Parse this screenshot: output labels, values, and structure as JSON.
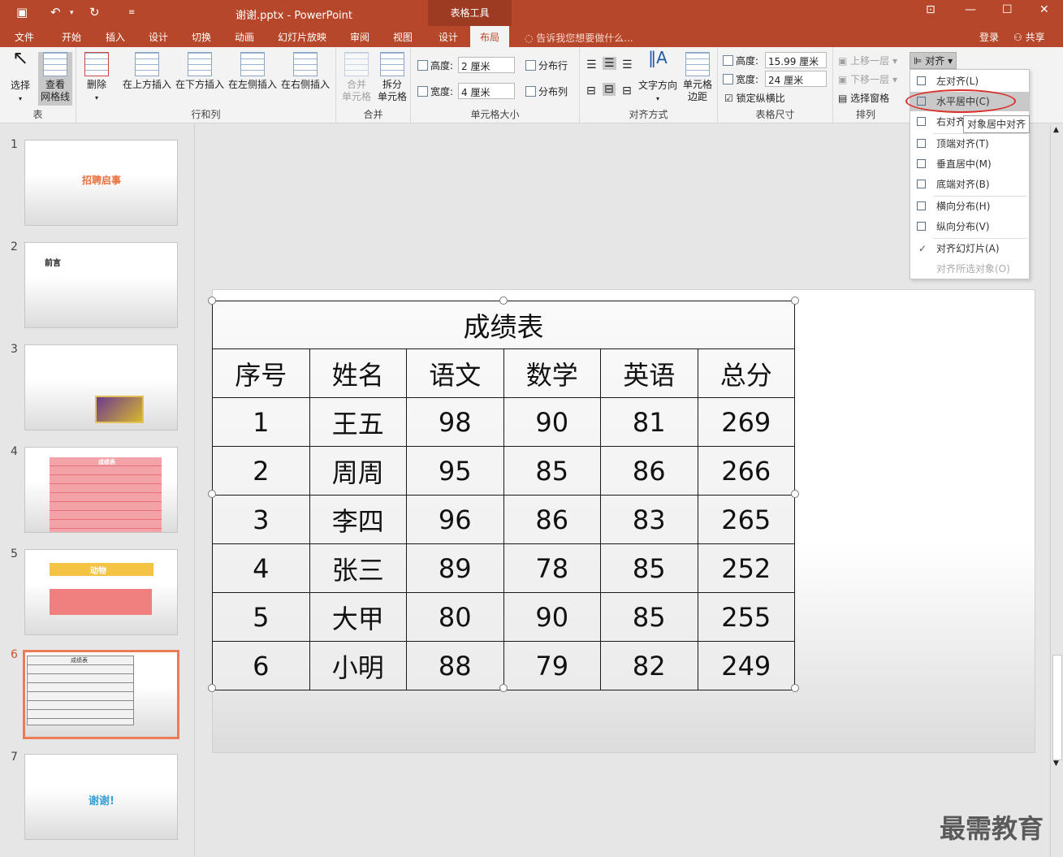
{
  "app": {
    "title": "谢谢.pptx - PowerPoint",
    "context_tab_group": "表格工具"
  },
  "tabs": [
    "文件",
    "开始",
    "插入",
    "设计",
    "切换",
    "动画",
    "幻灯片放映",
    "审阅",
    "视图",
    "设计",
    "布局"
  ],
  "active_tab": "布局",
  "tell_me": "告诉我您想要做什么...",
  "account": {
    "login": "登录",
    "share": "共享"
  },
  "ribbon": {
    "table": {
      "label": "表",
      "select": "选择",
      "view_gridlines": "查看\n网格线"
    },
    "rows_cols": {
      "label": "行和列",
      "delete": "删除",
      "insert_above": "在上方插入",
      "insert_below": "在下方插入",
      "insert_left": "在左侧插入",
      "insert_right": "在右侧插入"
    },
    "merge": {
      "label": "合并",
      "merge_cells": "合并\n单元格",
      "split_cells": "拆分\n单元格"
    },
    "cell_size": {
      "label": "单元格大小",
      "height_label": "高度:",
      "height_value": "2 厘米",
      "width_label": "宽度:",
      "width_value": "4 厘米",
      "distribute_rows": "分布行",
      "distribute_cols": "分布列"
    },
    "alignment": {
      "label": "对齐方式",
      "text_direction": "文字方向",
      "cell_margins": "单元格\n边距"
    },
    "table_size": {
      "label": "表格尺寸",
      "height_label": "高度:",
      "height_value": "15.99 厘米",
      "width_label": "宽度:",
      "width_value": "24 厘米",
      "lock_ratio": "锁定纵横比"
    },
    "arrange": {
      "label": "排列",
      "bring_forward": "上移一层",
      "send_backward": "下移一层",
      "selection_pane": "选择窗格",
      "align": "对齐"
    }
  },
  "align_menu": {
    "items": [
      {
        "label": "左对齐(L)",
        "state": "normal"
      },
      {
        "label": "水平居中(C)",
        "state": "highlighted"
      },
      {
        "label": "右对齐",
        "state": "normal"
      },
      {
        "label": "顶端对齐(T)",
        "state": "normal"
      },
      {
        "label": "垂直居中(M)",
        "state": "normal"
      },
      {
        "label": "底端对齐(B)",
        "state": "normal"
      },
      {
        "label": "横向分布(H)",
        "state": "normal"
      },
      {
        "label": "纵向分布(V)",
        "state": "normal"
      },
      {
        "label": "对齐幻灯片(A)",
        "state": "checked"
      },
      {
        "label": "对齐所选对象(O)",
        "state": "disabled"
      }
    ],
    "tooltip": "对象居中对齐"
  },
  "slides": [
    {
      "num": "1",
      "title": "招聘启事"
    },
    {
      "num": "2",
      "title": "前言"
    },
    {
      "num": "3",
      "title": ""
    },
    {
      "num": "4",
      "title": "成绩表"
    },
    {
      "num": "5",
      "title": "动物"
    },
    {
      "num": "6",
      "title": "成绩表",
      "selected": true
    },
    {
      "num": "7",
      "title": "谢谢!"
    }
  ],
  "grade_table": {
    "title": "成绩表",
    "headers": [
      "序号",
      "姓名",
      "语文",
      "数学",
      "英语",
      "总分"
    ],
    "rows": [
      [
        "1",
        "王五",
        "98",
        "90",
        "81",
        "269"
      ],
      [
        "2",
        "周周",
        "95",
        "85",
        "86",
        "266"
      ],
      [
        "3",
        "李四",
        "96",
        "86",
        "83",
        "265"
      ],
      [
        "4",
        "张三",
        "89",
        "78",
        "85",
        "252"
      ],
      [
        "5",
        "大甲",
        "80",
        "90",
        "85",
        "255"
      ],
      [
        "6",
        "小明",
        "88",
        "79",
        "82",
        "249"
      ]
    ]
  },
  "watermark": "最需教育",
  "colors": {
    "accent": "#b7472a",
    "highlight_circle": "#d9302a"
  }
}
